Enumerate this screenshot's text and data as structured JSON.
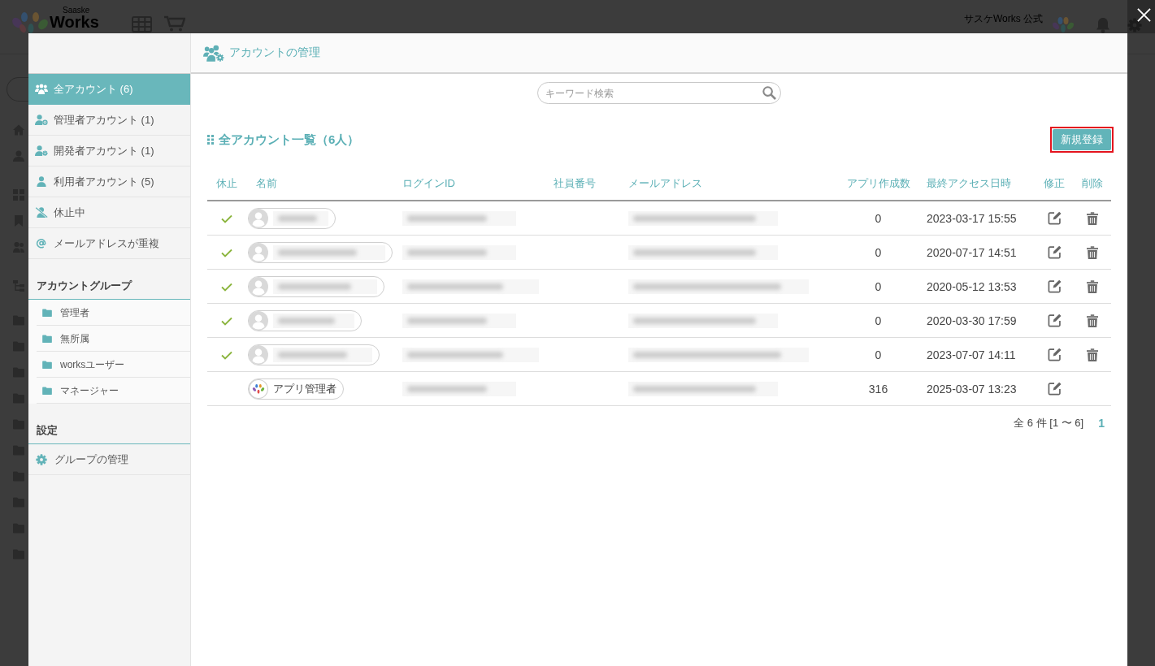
{
  "background": {
    "logo_subtitle": "Saaske",
    "logo_title": "Works",
    "account_name": "サスケWorks 公式"
  },
  "dialog": {
    "title": "アカウントの管理"
  },
  "sidebar": {
    "items": [
      {
        "label": "全アカウント (6)",
        "selected": true
      },
      {
        "label": "管理者アカウント (1)",
        "selected": false
      },
      {
        "label": "開発者アカウント (1)",
        "selected": false
      },
      {
        "label": "利用者アカウント (5)",
        "selected": false
      },
      {
        "label": "休止中",
        "selected": false
      },
      {
        "label": "メールアドレスが重複",
        "selected": false
      }
    ],
    "groups_heading": "アカウントグループ",
    "groups": [
      "管理者",
      "無所属",
      "worksユーザー",
      "マネージャー"
    ],
    "settings_heading": "設定",
    "settings_items": [
      "グループの管理"
    ]
  },
  "search": {
    "placeholder": "キーワード検索"
  },
  "list": {
    "heading": "全アカウント一覧（6人）",
    "new_button": "新規登録",
    "new_button_highlighted": true
  },
  "table": {
    "columns": [
      "休止",
      "名前",
      "ログインID",
      "社員番号",
      "メールアドレス",
      "アプリ作成数",
      "最終アクセス日時",
      "修正",
      "削除"
    ],
    "rows": [
      {
        "checked": true,
        "kind": "user",
        "name_redacted": true,
        "login_id_redacted": true,
        "email_redacted": true,
        "apps": "0",
        "last_access": "2023-03-17 15:55",
        "deletable": true
      },
      {
        "checked": true,
        "kind": "user",
        "name_redacted": true,
        "login_id_redacted": true,
        "email_redacted": true,
        "apps": "0",
        "last_access": "2020-07-17 14:51",
        "deletable": true
      },
      {
        "checked": true,
        "kind": "user",
        "name_redacted": true,
        "login_id_redacted": true,
        "email_redacted": true,
        "apps": "0",
        "last_access": "2020-05-12 13:53",
        "deletable": true
      },
      {
        "checked": true,
        "kind": "user",
        "name_redacted": true,
        "login_id_redacted": true,
        "email_redacted": true,
        "apps": "0",
        "last_access": "2020-03-30 17:59",
        "deletable": true
      },
      {
        "checked": true,
        "kind": "user",
        "name_redacted": true,
        "login_id_redacted": true,
        "email_redacted": true,
        "apps": "0",
        "last_access": "2023-07-07 14:11",
        "deletable": true
      },
      {
        "checked": false,
        "kind": "app",
        "name_redacted": false,
        "name": "アプリ管理者",
        "login_id_redacted": true,
        "email_redacted": true,
        "apps": "316",
        "last_access": "2025-03-07 13:23",
        "deletable": false
      }
    ]
  },
  "pagination": {
    "summary": "全 6 件 [1 〜 6]",
    "pages": [
      "1"
    ]
  }
}
